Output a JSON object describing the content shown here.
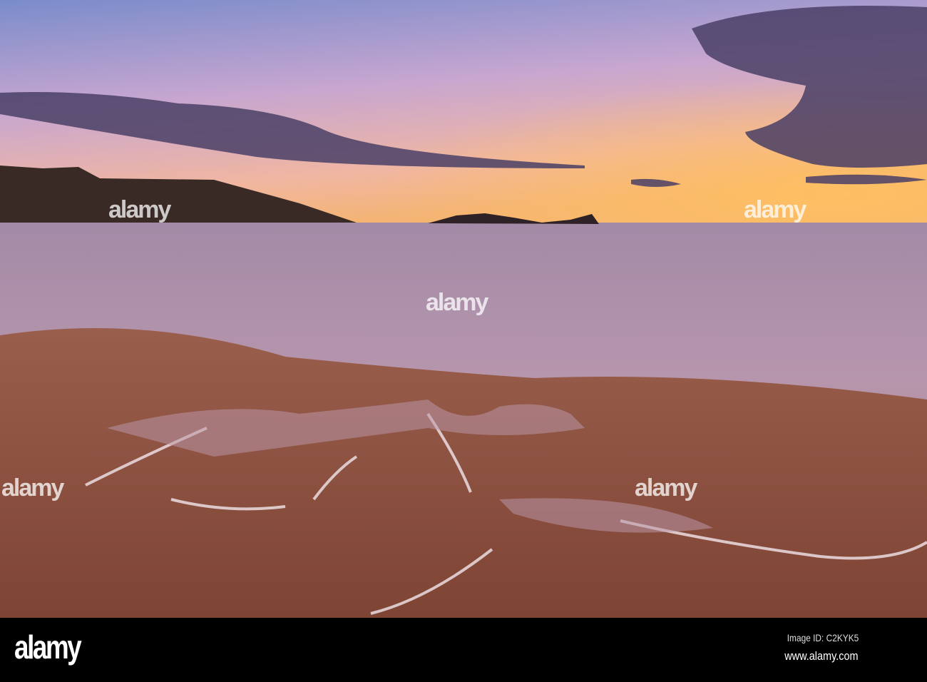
{
  "photo": {
    "subject": "sunset over sandy beach with receding tide",
    "colors": {
      "sky_top": "#7f8fc8",
      "sky_horizon": "#f6b56a",
      "sand": "#8c4f3a",
      "water": "#b995a8"
    }
  },
  "watermark": {
    "text": "alamy"
  },
  "footer": {
    "logo": "alamy",
    "image_id": "Image ID: C2KYK5",
    "url": "www.alamy.com"
  }
}
